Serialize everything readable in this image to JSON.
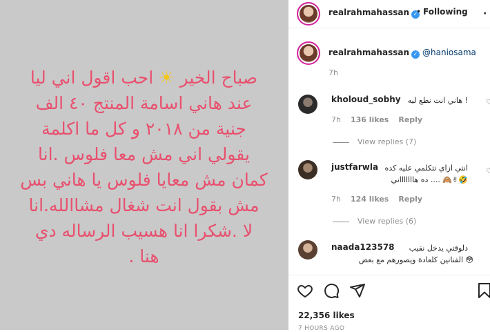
{
  "post": {
    "lines": [
      "صباح الخير",
      "احب اقول اني ليا",
      "عند هاني اسامة المنتج ٤٠ الف",
      "جنية من ٢٠١٨ و كل ما اكلمة",
      "يقولي اني مش معا فلوس .انا",
      "كمان مش معايا فلوس يا هاني بس",
      "مش بقول انت شغال مشاالله.انا",
      "لا .شكرا انا هسيب الرساله دي",
      "هنا ."
    ],
    "sun_emoji": "☀"
  },
  "header": {
    "username": "realrahmahassan",
    "separator": "•",
    "following_label": "Following",
    "more_icon": "ellipsis-icon"
  },
  "caption": {
    "username": "realrahmahassan",
    "mention": "@haniosama",
    "time": "7h"
  },
  "comments": [
    {
      "username": "kholoud_sobhy",
      "text": "! هاني انت نطع ليه",
      "time": "7h",
      "likes": "136 likes",
      "reply": "Reply",
      "view_replies": "View replies (7)"
    },
    {
      "username": "justfarwla",
      "text_line1": "انتي ازاي تتكلمي عليه كده",
      "text_line2": "🤣✌🙈 .... ده هاااااااني",
      "time": "7h",
      "likes": "124 likes",
      "reply": "Reply",
      "view_replies": "View replies (6)"
    },
    {
      "username": "naada123578",
      "text_line1": "دلوقتي يدخل نقيب",
      "text_line2": "😳 الفنانين كلعادة ويصورهم مع بعض"
    }
  ],
  "actions": {
    "like_icon": "heart-icon",
    "comment_icon": "comment-icon",
    "share_icon": "share-icon",
    "save_icon": "bookmark-icon"
  },
  "likes_count": "22,356 likes",
  "time_ago": "7 HOURS AGO",
  "colors": {
    "post_bg": "#c9c9c9",
    "post_text": "#e8506e",
    "link": "#00376b",
    "muted": "#8e8e8e",
    "verified": "#3897f0"
  }
}
